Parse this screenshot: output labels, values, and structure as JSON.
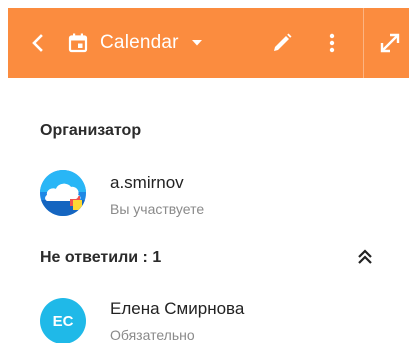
{
  "toolbar": {
    "background": "#fb8c3f",
    "back_icon": "chevron-left-icon",
    "calendar_icon": "calendar-icon",
    "calendar_label": "Calendar",
    "caret_icon": "caret-down-icon",
    "edit_icon": "pencil-icon",
    "more_icon": "more-vertical-icon",
    "expand_icon": "expand-icon"
  },
  "organizer": {
    "title": "Организатор",
    "name": "a.smirnov",
    "status": "Вы участвуете",
    "avatar_icon": "cloud-avatar-icon"
  },
  "no_answer": {
    "title": "Не ответили : 1",
    "collapse_icon": "double-chevron-up-icon",
    "attendees": [
      {
        "initials": "ЕС",
        "name": "Елена Смирнова",
        "status": "Обязательно",
        "avatar_color": "#1fb9e8"
      }
    ]
  }
}
